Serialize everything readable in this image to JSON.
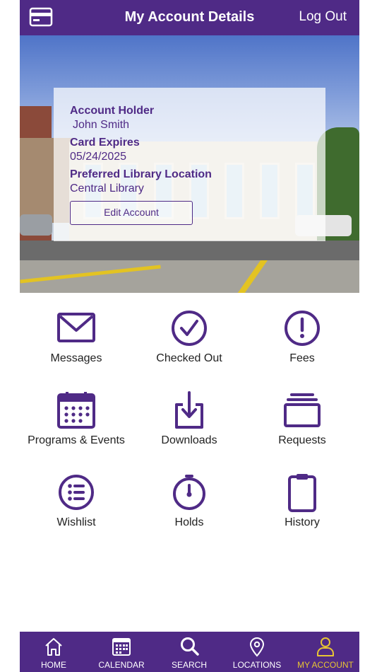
{
  "header": {
    "title": "My Account Details",
    "logout_label": "Log Out",
    "card_icon": "card-icon"
  },
  "account": {
    "holder_label": "Account Holder",
    "holder_value": "John Smith",
    "expires_label": "Card Expires",
    "expires_value": "05/24/2025",
    "location_label": "Preferred Library Location",
    "location_value": "Central Library",
    "edit_button": "Edit Account"
  },
  "tiles": [
    {
      "label": "Messages",
      "icon": "envelope-icon"
    },
    {
      "label": "Checked Out",
      "icon": "checkmark-circle-icon"
    },
    {
      "label": "Fees",
      "icon": "exclamation-circle-icon"
    },
    {
      "label": "Programs & Events",
      "icon": "calendar-icon"
    },
    {
      "label": "Downloads",
      "icon": "download-icon"
    },
    {
      "label": "Requests",
      "icon": "stack-icon"
    },
    {
      "label": "Wishlist",
      "icon": "list-icon"
    },
    {
      "label": "Holds",
      "icon": "timer-icon"
    },
    {
      "label": "History",
      "icon": "clipboard-icon"
    }
  ],
  "tabbar": [
    {
      "label": "HOME",
      "icon": "home-icon"
    },
    {
      "label": "CALENDAR",
      "icon": "calendar-icon"
    },
    {
      "label": "SEARCH",
      "icon": "search-icon"
    },
    {
      "label": "LOCATIONS",
      "icon": "location-pin-icon"
    },
    {
      "label": "MY ACCOUNT",
      "icon": "user-icon",
      "active": true
    }
  ],
  "colors": {
    "brand": "#4f2a86",
    "active_tab": "#e8c534",
    "background": "#ffffff"
  }
}
